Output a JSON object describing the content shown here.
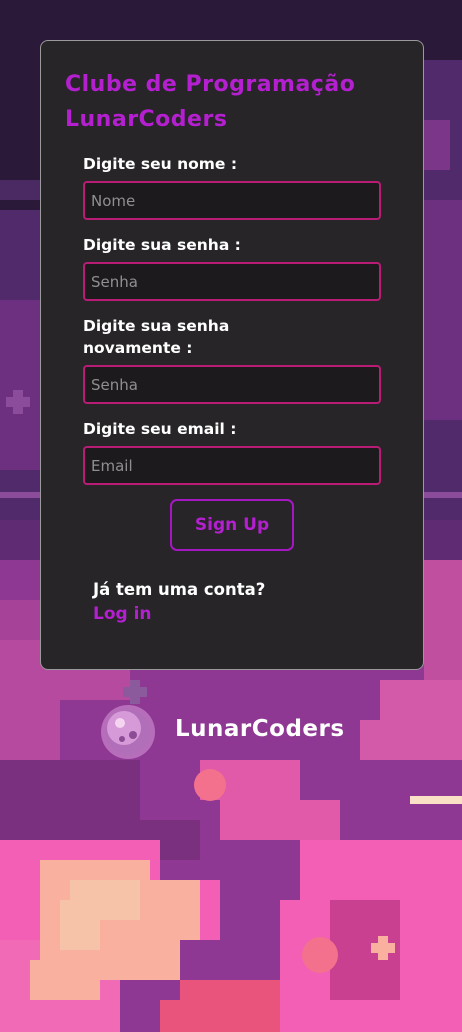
{
  "form": {
    "title_line1": "Clube de Programação",
    "title_line2": "LunarCoders",
    "name_label": "Digite seu nome :",
    "name_placeholder": "Nome",
    "password_label": "Digite sua senha :",
    "password_placeholder": "Senha",
    "confirm_label": "Digite sua senha novamente :",
    "confirm_placeholder": "Senha",
    "email_label": "Digite seu email :",
    "email_placeholder": "Email",
    "signup_label": "Sign Up",
    "account_question": "Já tem uma conta?",
    "login_label": "Log in"
  },
  "brand": {
    "name": "LunarCoders",
    "logo_icon": "moon-logo-icon"
  },
  "colors": {
    "accent": "#b41fd0",
    "input_border": "#b81c74",
    "card_bg": "#272528",
    "background_dark": "#2a1938",
    "background_pink": "#f25fb4",
    "background_peach": "#f9b09e"
  }
}
